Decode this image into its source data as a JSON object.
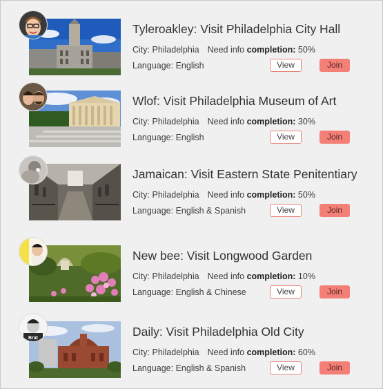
{
  "tours": [
    {
      "title": "Tyleroakley: Visit Philadelphia City Hall",
      "city_label": "City:",
      "city": "Philadelphia",
      "need_label": "Need info",
      "completion_label": "completion:",
      "completion": "50%",
      "language_label": "Language:",
      "language": "English",
      "view_label": "View",
      "join_label": "Join",
      "thumb": "city-hall"
    },
    {
      "title": "Wlof: Visit Philadelphia Museum of Art",
      "city_label": "City:",
      "city": "Philadelphia",
      "need_label": "Need info",
      "completion_label": "completion:",
      "completion": "30%",
      "language_label": "Language:",
      "language": "English",
      "view_label": "View",
      "join_label": "Join",
      "thumb": "museum-of-art"
    },
    {
      "title": "Jamaican: Visit Eastern State Penitentiary",
      "city_label": "City:",
      "city": "Philadelphia",
      "need_label": "Need info",
      "completion_label": "completion:",
      "completion": "50%",
      "language_label": "Language:",
      "language": "English & Spanish",
      "view_label": "View",
      "join_label": "Join",
      "thumb": "penitentiary"
    },
    {
      "title": "New bee: Visit Longwood Garden",
      "city_label": "City:",
      "city": "Philadelphia",
      "need_label": "Need info",
      "completion_label": "completion:",
      "completion": "10%",
      "language_label": "Language:",
      "language": "English & Chinese",
      "view_label": "View",
      "join_label": "Join",
      "thumb": "garden"
    },
    {
      "title": "Daily: Visit Philadelphia Old City",
      "city_label": "City:",
      "city": "Philadelphia",
      "need_label": "Need info",
      "completion_label": "completion:",
      "completion": "60%",
      "language_label": "Language:",
      "language": "English & Spanish",
      "view_label": "View",
      "join_label": "Join",
      "thumb": "old-city",
      "avatar_text": "Brat"
    }
  ],
  "colors": {
    "join_bg": "#f37f77",
    "view_border": "#e8847b"
  }
}
